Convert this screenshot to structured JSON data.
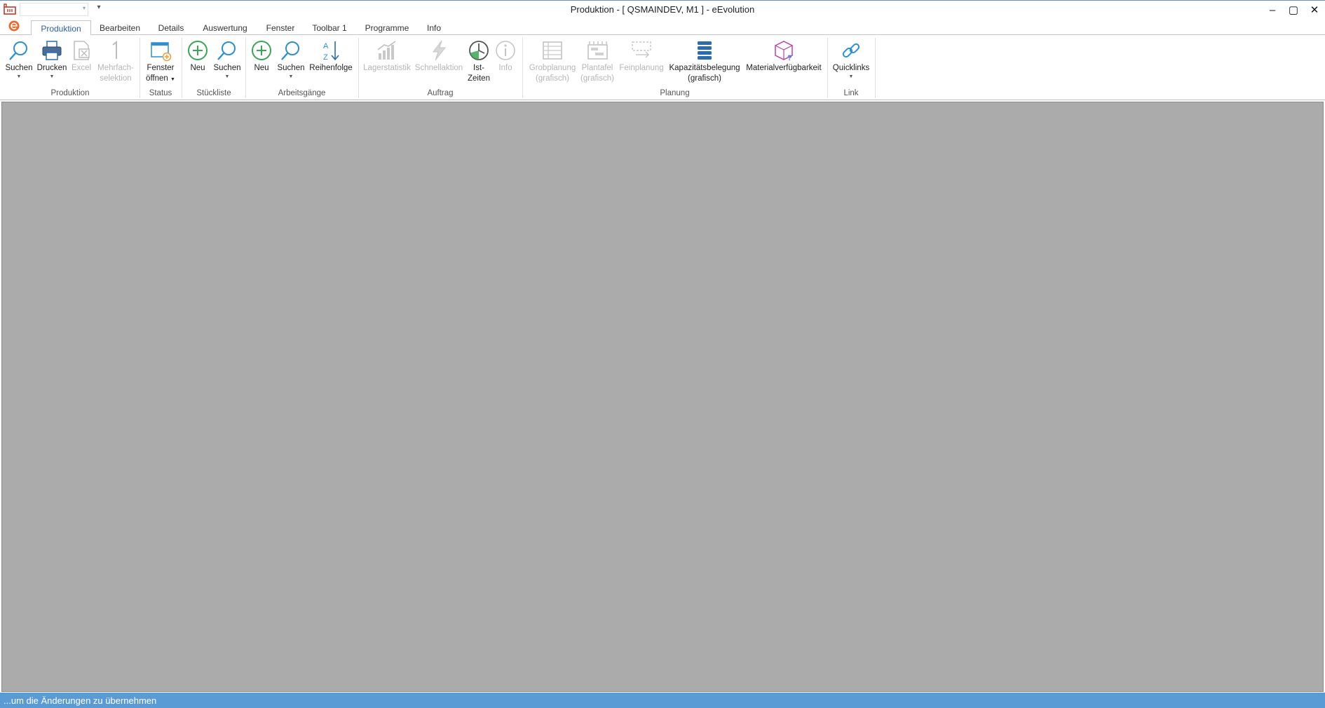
{
  "window": {
    "title": "Produktion - [ QSMAINDEV, M1 ]  -  eEvolution",
    "minimize_label": "–",
    "maximize_label": "▢",
    "close_label": "✕"
  },
  "tabs": [
    {
      "label": "Produktion",
      "active": true
    },
    {
      "label": "Bearbeiten"
    },
    {
      "label": "Details"
    },
    {
      "label": "Auswertung"
    },
    {
      "label": "Fenster"
    },
    {
      "label": "Toolbar 1"
    },
    {
      "label": "Programme"
    },
    {
      "label": "Info"
    }
  ],
  "ribbon": {
    "groups": {
      "produktion": "Produktion",
      "status": "Status",
      "stueckliste": "Stückliste",
      "arbeitsgaenge": "Arbeitsgänge",
      "auftrag": "Auftrag",
      "planung": "Planung",
      "link": "Link"
    },
    "buttons": {
      "suchen": {
        "line1": "Suchen"
      },
      "drucken": {
        "line1": "Drucken"
      },
      "excel": {
        "line1": "Excel"
      },
      "mehrfach": {
        "line1": "Mehrfach-",
        "line2": "selektion"
      },
      "fenster": {
        "line1": "Fenster",
        "line2": "öffnen"
      },
      "stl_neu": {
        "line1": "Neu"
      },
      "stl_suchen": {
        "line1": "Suchen"
      },
      "ag_neu": {
        "line1": "Neu"
      },
      "ag_suchen": {
        "line1": "Suchen"
      },
      "reihenfolge": {
        "line1": "Reihenfolge"
      },
      "lagerstatistik": {
        "line1": "Lagerstatistik"
      },
      "schnellaktion": {
        "line1": "Schnellaktion"
      },
      "istzeiten": {
        "line1": "Ist-",
        "line2": "Zeiten"
      },
      "info": {
        "line1": "Info"
      },
      "grobplanung": {
        "line1": "Grobplanung",
        "line2": "(grafisch)"
      },
      "plantafel": {
        "line1": "Plantafel",
        "line2": "(grafisch)"
      },
      "feinplanung": {
        "line1": "Feinplanung"
      },
      "kapazitaet": {
        "line1": "Kapazitätsbelegung",
        "line2": "(grafisch)"
      },
      "material": {
        "line1": "Materialverfügbarkeit"
      },
      "quicklinks": {
        "line1": "Quicklinks"
      }
    }
  },
  "statusbar": {
    "text": "...um die Änderungen zu übernehmen"
  },
  "colors": {
    "accent": "#2a5fa8",
    "statusbar": "#5b9bd5",
    "workspace": "#ababab",
    "green": "#3aa655",
    "disabled": "#b5b5b5"
  }
}
